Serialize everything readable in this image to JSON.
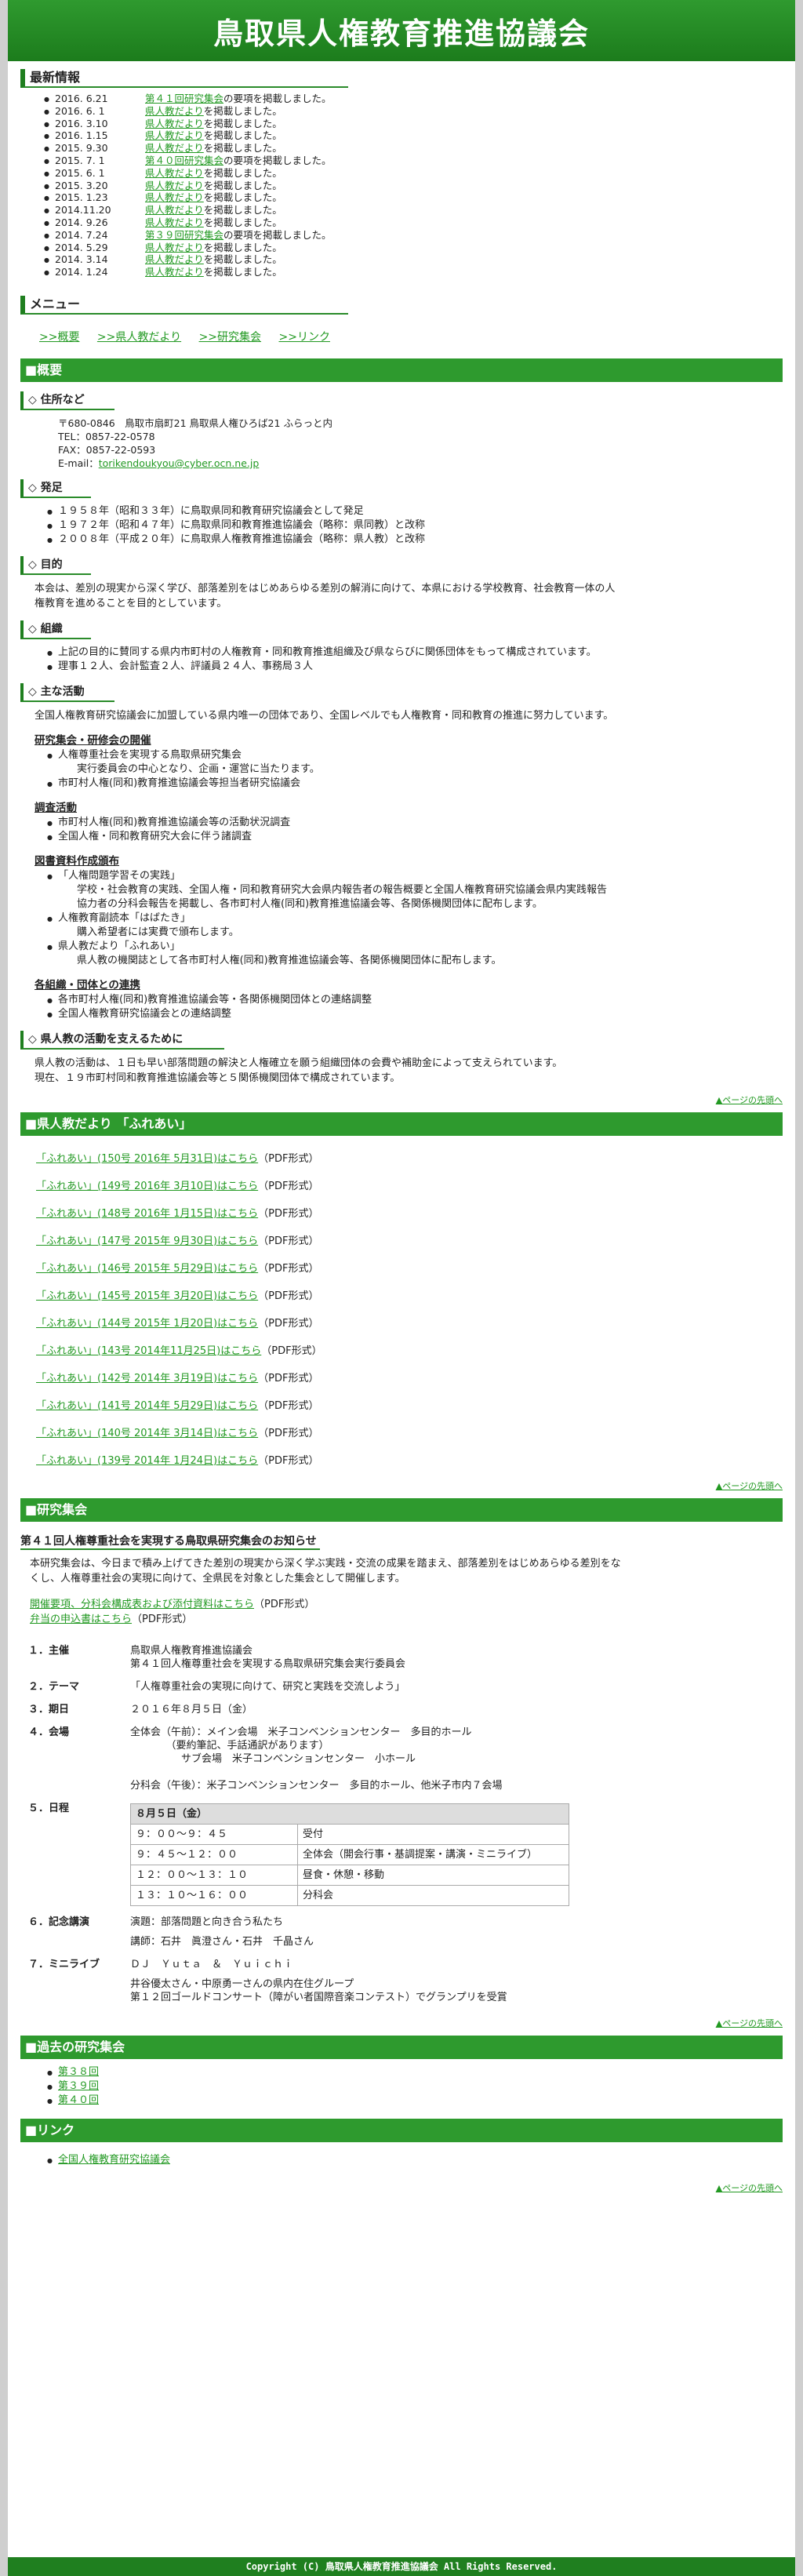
{
  "header": {
    "title": "鳥取県人権教育推進協議会"
  },
  "news": {
    "heading": "最新情報",
    "items": [
      {
        "date": "2016. 6.21",
        "link": "第４１回研究集会",
        "text": "の要項を掲載しました。"
      },
      {
        "date": "2016. 6. 1",
        "link": "県人教だより",
        "text": "を掲載しました。"
      },
      {
        "date": "2016. 3.10",
        "link": "県人教だより",
        "text": "を掲載しました。"
      },
      {
        "date": "2016. 1.15",
        "link": "県人教だより",
        "text": "を掲載しました。"
      },
      {
        "date": "2015. 9.30",
        "link": "県人教だより",
        "text": "を掲載しました。"
      },
      {
        "date": "2015. 7. 1",
        "link": "第４０回研究集会",
        "text": "の要項を掲載しました。"
      },
      {
        "date": "2015. 6. 1",
        "link": "県人教だより",
        "text": "を掲載しました。"
      },
      {
        "date": "2015. 3.20",
        "link": "県人教だより",
        "text": "を掲載しました。"
      },
      {
        "date": "2015. 1.23",
        "link": "県人教だより",
        "text": "を掲載しました。"
      },
      {
        "date": "2014.11.20",
        "link": "県人教だより",
        "text": "を掲載しました。"
      },
      {
        "date": "2014. 9.26",
        "link": "県人教だより",
        "text": "を掲載しました。"
      },
      {
        "date": "2014. 7.24",
        "link": "第３９回研究集会",
        "text": "の要項を掲載しました。"
      },
      {
        "date": "2014. 5.29",
        "link": "県人教だより",
        "text": "を掲載しました。"
      },
      {
        "date": "2014. 3.14",
        "link": "県人教だより",
        "text": "を掲載しました。"
      },
      {
        "date": "2014. 1.24",
        "link": "県人教だより",
        "text": "を掲載しました。"
      }
    ]
  },
  "menu": {
    "heading": "メニュー",
    "items": [
      ">>概要",
      ">>県人教だより",
      ">>研究集会",
      ">>リンク"
    ]
  },
  "overview": {
    "heading": "■概要",
    "address_h": "◇ 住所など",
    "address": [
      "〒680-0846　鳥取市扇町21 鳥取県人権ひろば21 ふらっと内",
      "TEL：0857-22-0578",
      "FAX：0857-22-0593",
      "E-mail：torikendoukyou@cyber.ocn.ne.jp"
    ],
    "start_h": "◇ 発足",
    "start": [
      "１９５８年（昭和３３年）に鳥取県同和教育研究協議会として発足",
      "１９７２年（昭和４７年）に鳥取県同和教育推進協議会（略称：県同教）と改称",
      "２００８年（平成２０年）に鳥取県人権教育推進協議会（略称：県人教）と改称"
    ],
    "purpose_h": "◇ 目的",
    "purpose": "本会は、差別の現実から深く学び、部落差別をはじめあらゆる差別の解消に向けて、本県における学校教育、社会教育一体の人権教育を進めることを目的としています。",
    "org_h": "◇ 組織",
    "org": [
      "上記の目的に賛同する県内市町村の人権教育・同和教育推進組織及び県ならびに関係団体をもって構成されています。",
      "理事１２人、会計監査２人、評議員２４人、事務局３人"
    ],
    "act_h": "◇ 主な活動",
    "act": "全国人権教育研究協議会に加盟している県内唯一の団体であり、全国レベルでも人権教育・同和教育の推進に努力しています。",
    "act1_h": "研究集会・研修会の開催",
    "act1": [
      "人権尊重社会を実現する鳥取県研究集会",
      "実行委員会の中心となり、企画・運営に当たります。",
      "市町村人権(同和)教育推進協議会等担当者研究協議会"
    ],
    "act2_h": "調査活動",
    "act2": [
      "市町村人権(同和)教育推進協議会等の活動状況調査",
      "全国人権・同和教育研究大会に伴う諸調査"
    ],
    "act3_h": "図書資料作成頒布",
    "act3": [
      "「人権問題学習その実践」",
      "学校・社会教育の実践、全国人権・同和教育研究大会県内報告者の報告概要と全国人権教育研究協議会県内実践報告協力者の分科会報告を掲載し、各市町村人権(同和)教育推進協議会等、各関係機関団体に配布します。",
      "人権教育副読本「はばたき」",
      "購入希望者には実費で頒布します。",
      "県人教だより「ふれあい」",
      "県人教の機関誌として各市町村人権(同和)教育推進協議会等、各関係機関団体に配布します。"
    ],
    "act4_h": "各組織・団体との連携",
    "act4": [
      "各市町村人権(同和)教育推進協議会等・各関係機関団体との連絡調整",
      "全国人権教育研究協議会との連絡調整"
    ],
    "support_h": "◇ 県人教の活動を支えるために",
    "support": [
      "県人教の活動は、１日も早い部落問題の解決と人権確立を願う組織団体の会費や補助金によって支えられています。",
      "現在、１９市町村同和教育推進協議会等と５関係機関団体で構成されています。"
    ]
  },
  "pagetop": "▲ページの先頭へ",
  "dayori": {
    "heading": "■県人教だより 「ふれあい」",
    "pdf": "（PDF形式）",
    "items": [
      "「ふれあい」(150号 2016年 5月31日)はこちら",
      "「ふれあい」(149号 2016年 3月10日)はこちら",
      "「ふれあい」(148号 2016年 1月15日)はこちら",
      "「ふれあい」(147号 2015年 9月30日)はこちら",
      "「ふれあい」(146号 2015年 5月29日)はこちら",
      "「ふれあい」(145号 2015年 3月20日)はこちら",
      "「ふれあい」(144号 2015年 1月20日)はこちら",
      "「ふれあい」(143号 2014年11月25日)はこちら",
      "「ふれあい」(142号 2014年 3月19日)はこちら",
      "「ふれあい」(141号 2014年 5月29日)はこちら",
      "「ふれあい」(140号 2014年 3月14日)はこちら",
      "「ふれあい」(139号 2014年 1月24日)はこちら"
    ]
  },
  "kenkyu": {
    "heading": "■研究集会",
    "title": "第４１回人権尊重社会を実現する鳥取県研究集会のお知らせ",
    "desc": "本研究集会は、今日まで積み上げてきた差別の現実から深く学ぶ実践・交流の成果を踏まえ、部落差別をはじめあらゆる差別をなくし、人権尊重社会の実現に向けて、全県民を対象とした集会として開催します。",
    "link1": "開催要項、分科会構成表および添付資料はこちら",
    "link2": "弁当の申込書はこちら",
    "pdf": "（PDF形式）",
    "rows": [
      {
        "k": "１．主催",
        "v": "鳥取県人権教育推進協議会\n第４１回人権尊重社会を実現する鳥取県研究集会実行委員会"
      },
      {
        "k": "２．テーマ",
        "v": "「人権尊重社会の実現に向けて、研究と実践を交流しよう」"
      },
      {
        "k": "３．期日",
        "v": "２０１６年８月５日（金）"
      },
      {
        "k": "４．会場",
        "v": "全体会（午前）：メイン会場　米子コンベンションセンター　多目的ホール\n　　　　（要約筆記、手話通訳があります）\n　　　　　サブ会場　米子コンベンションセンター　小ホール\n\n分科会（午後）：米子コンベンションセンター　多目的ホール、他米子市内７会場"
      }
    ],
    "sched_k": "５．日程",
    "sched_hdr": "８月５日（金）",
    "sched": [
      [
        "９：００～９：４５",
        "受付"
      ],
      [
        "９：４５～１２：００",
        "全体会（開会行事・基調提案・講演・ミニライブ）"
      ],
      [
        "１２：００～１３：１０",
        "昼食・休憩・移動"
      ],
      [
        "１３：１０～１６：００",
        "分科会"
      ]
    ],
    "lecture_k": "６．記念講演",
    "lecture": [
      "演題：部落問題と向き合う私たち",
      "講師：石井　眞澄さん・石井　千晶さん"
    ],
    "live_k": "７．ミニライブ",
    "live": [
      "ＤＪ　Ｙｕｔａ　＆　Ｙｕｉｃｈｉ",
      "井谷優太さん・中原勇一さんの県内在住グループ\n第１２回ゴールドコンサート（障がい者国際音楽コンテスト）でグランプリを受賞"
    ]
  },
  "past": {
    "heading": "■過去の研究集会",
    "items": [
      "第３８回",
      "第３９回",
      "第４０回"
    ]
  },
  "links": {
    "heading": "■リンク",
    "items": [
      "全国人権教育研究協議会"
    ]
  },
  "footer": "Copyright (C) 鳥取県人権教育推進協議会 All Rights Reserved."
}
